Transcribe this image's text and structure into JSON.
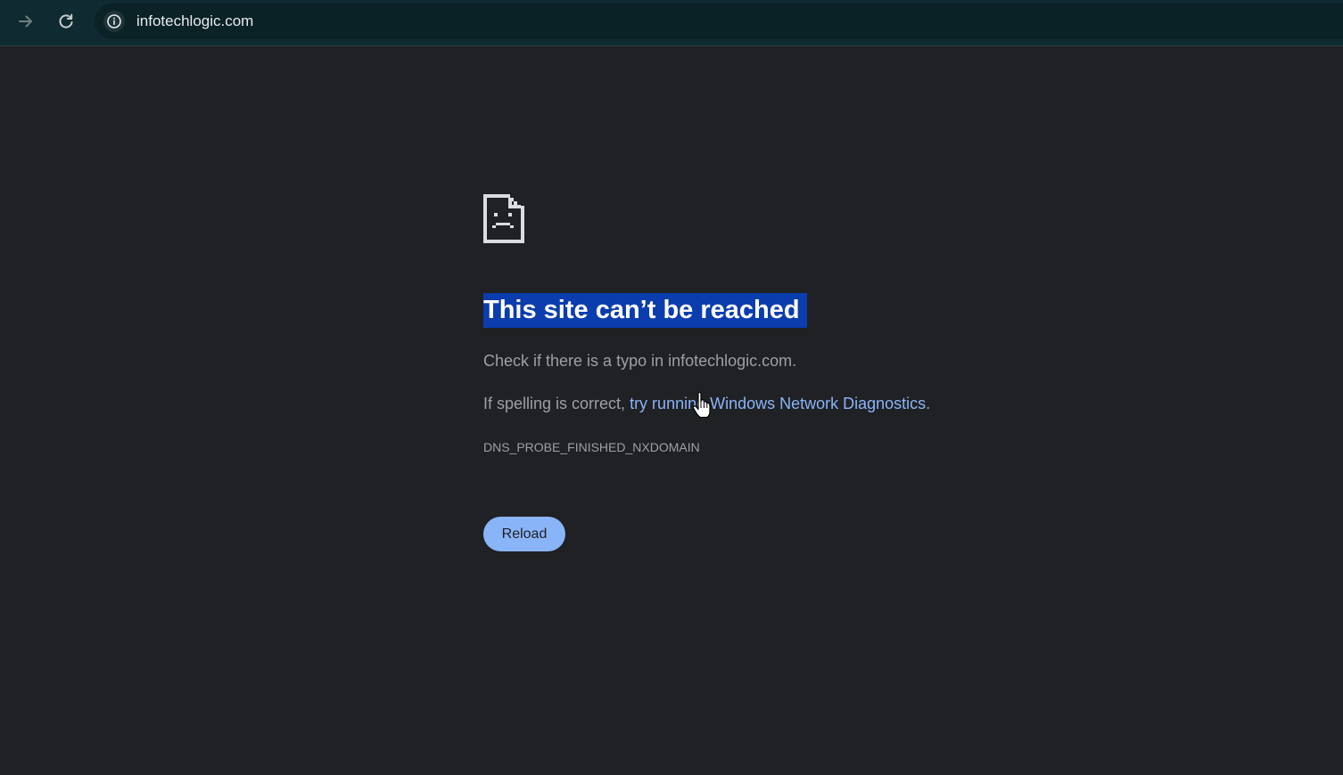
{
  "browser": {
    "url": "infotechlogic.com",
    "forward_icon": "arrow-right-icon",
    "reload_icon": "reload-icon",
    "site_info_icon": "info-icon"
  },
  "error_page": {
    "icon": "sad-document-icon",
    "title": "This site can’t be reached",
    "check_message": "Check if there is a typo in infotechlogic.com.",
    "spelling_prefix": "If spelling is correct, ",
    "diagnostics_link": "try running Windows Network Diagnostics",
    "spelling_suffix": ".",
    "error_code": "DNS_PROBE_FINISHED_NXDOMAIN",
    "reload_button": "Reload"
  },
  "colors": {
    "page_background": "#202124",
    "toolbar_background": "#0f2a30",
    "link": "#8ab4f8",
    "title_highlight": "#0b3dae",
    "button": "#8ab4f8"
  }
}
